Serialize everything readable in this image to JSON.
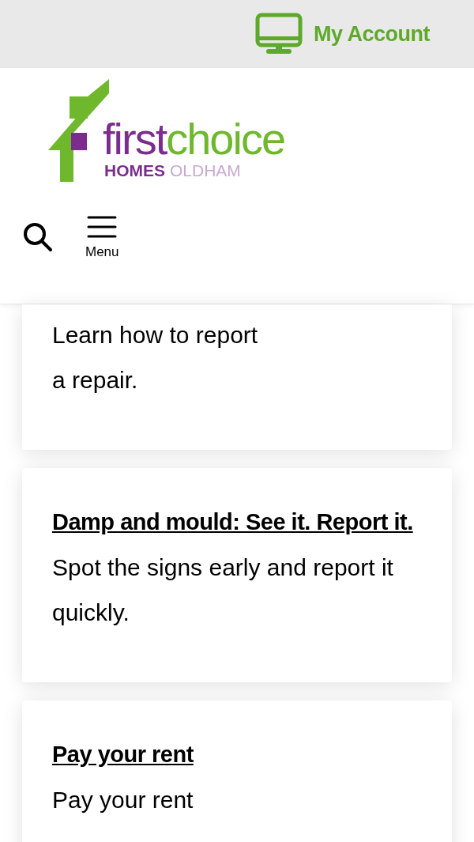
{
  "top_bar": {
    "account_link": "My Account"
  },
  "logo": {
    "word_1": "first",
    "word_2": "choice",
    "line_2a": "HOMES",
    "line_2b": "OLDHAM"
  },
  "menu_label": "Menu",
  "cards": [
    {
      "text": "Learn how to report\na repair."
    },
    {
      "title": "Damp and mould: See it. Report it.",
      "text": "Spot the signs early and report it quickly."
    },
    {
      "title": "Pay your rent",
      "text": "Pay your rent"
    }
  ]
}
